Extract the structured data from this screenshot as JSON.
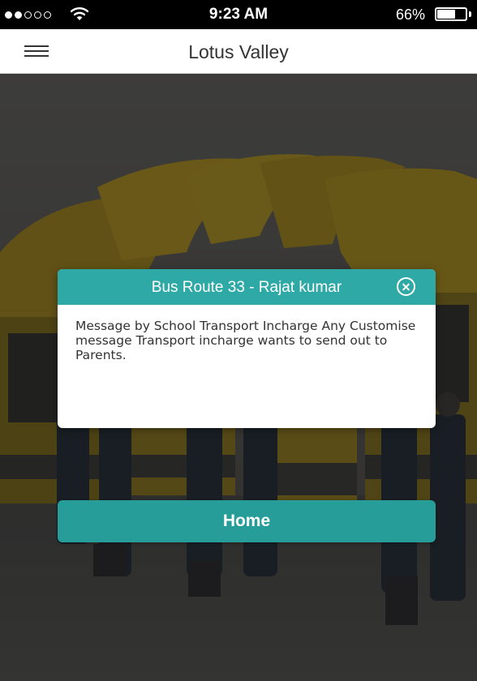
{
  "status_bar": {
    "signal_filled": 2,
    "signal_total": 5,
    "wifi_icon": "wifi-icon",
    "time": "9:23 AM",
    "battery_percent": "66%",
    "battery_level": 0.66,
    "battery_icon": "battery-icon"
  },
  "nav_bar": {
    "menu_icon": "hamburger-menu-icon",
    "title": "Lotus Valley"
  },
  "background": {
    "image": "school-buses-with-staff-photo"
  },
  "modal": {
    "title": "Bus Route 33 - Rajat kumar",
    "close_icon": "close-circle-icon",
    "message": "Message by School Transport Incharge Any Customise message Transport incharge wants to send out to Parents."
  },
  "home_button": {
    "label": "Home"
  },
  "colors": {
    "accent": "#2fa9a6",
    "button": "#279d9a",
    "status_bar": "#000000",
    "nav_bar": "#ffffff"
  }
}
